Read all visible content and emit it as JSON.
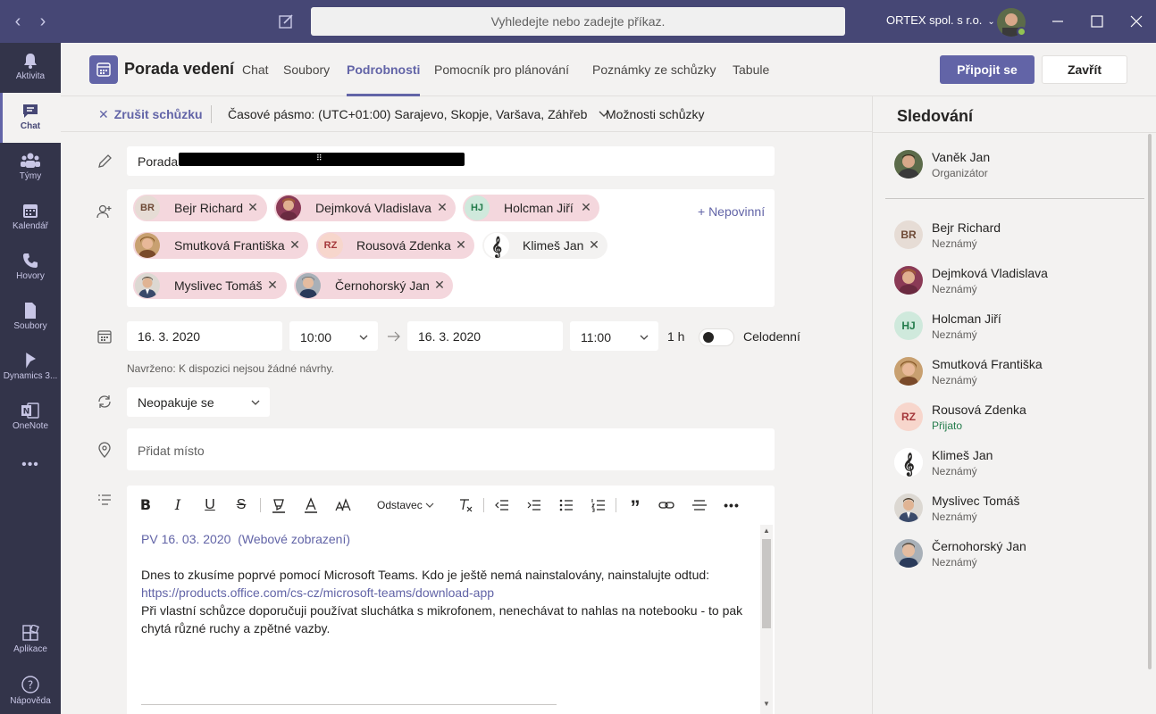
{
  "titlebar": {
    "search_placeholder": "Vyhledejte nebo zadejte příkaz.",
    "org_name": "ORTEX spol. s r.o."
  },
  "rail": {
    "items": [
      {
        "label": "Aktivita",
        "icon": "bell-icon"
      },
      {
        "label": "Chat",
        "icon": "chat-icon"
      },
      {
        "label": "Týmy",
        "icon": "teams-icon"
      },
      {
        "label": "Kalendář",
        "icon": "calendar-icon"
      },
      {
        "label": "Hovory",
        "icon": "phone-icon"
      },
      {
        "label": "Soubory",
        "icon": "file-icon"
      },
      {
        "label": "Dynamics 3...",
        "icon": "dynamics-icon"
      },
      {
        "label": "OneNote",
        "icon": "onenote-icon"
      }
    ],
    "more": "•••",
    "apps_label": "Aplikace",
    "help_label": "Nápověda"
  },
  "header": {
    "title": "Porada vedení",
    "tabs": [
      "Chat",
      "Soubory",
      "Podrobnosti",
      "Pomocník pro plánování",
      "Poznámky ze schůzky",
      "Tabule"
    ],
    "active_tab": "Podrobnosti",
    "join_label": "Připojit se",
    "close_label": "Zavřít"
  },
  "toolbar": {
    "cancel_label": "Zrušit schůzku",
    "timezone": "Časové pásmo: (UTC+01:00) Sarajevo, Skopje, Varšava, Záhřeb",
    "options_label": "Možnosti schůzky"
  },
  "form": {
    "title_value": "Porada",
    "title_redacted_glyph": "⠿",
    "attendees": [
      {
        "initials": "BR",
        "name": "Bejr Richard"
      },
      {
        "initials": "",
        "name": "Dejmková Vladislava"
      },
      {
        "initials": "HJ",
        "name": "Holcman Jiří"
      },
      {
        "initials": "",
        "name": "Smutková Františka"
      },
      {
        "initials": "RZ",
        "name": "Rousová Zdenka"
      },
      {
        "initials": "",
        "name": "Klimeš Jan"
      },
      {
        "initials": "",
        "name": "Myslivec Tomáš"
      },
      {
        "initials": "",
        "name": "Černohorský Jan"
      }
    ],
    "optional_label": "+ Nepovinní",
    "start_date": "16. 3. 2020",
    "start_time": "10:00",
    "end_date": "16. 3. 2020",
    "end_time": "11:00",
    "duration": "1 h",
    "all_day_label": "Celodenní",
    "suggestion": "Navrženo: K dispozici nejsou žádné návrhy.",
    "repeat_value": "Neopakuje se",
    "location_placeholder": "Přidat místo"
  },
  "editor": {
    "paragraph_label": "Odstavec",
    "line1_a": "PV 16. 03. 2020",
    "line1_b": "(Webové zobrazení)",
    "body_text": "Dnes to zkusíme poprvé pomocí Microsoft Teams. Kdo je ještě nemá nainstalovány, nainstalujte odtud:",
    "link": "https://products.office.com/cs-cz/microsoft-teams/download-app",
    "body_text2": "Při vlastní schůzce doporučuji používat sluchátka s mikrofonem, nenechávat to nahlas na notebooku - to pak chytá různé ruchy a zpětné vazby."
  },
  "panel": {
    "title": "Sledování",
    "organizer": {
      "name": "Vaněk Jan",
      "status": "Organizátor"
    },
    "people": [
      {
        "initials": "BR",
        "name": "Bejr Richard",
        "status": "Neznámý"
      },
      {
        "initials": "",
        "name": "Dejmková Vladislava",
        "status": "Neznámý"
      },
      {
        "initials": "HJ",
        "name": "Holcman Jiří",
        "status": "Neznámý"
      },
      {
        "initials": "",
        "name": "Smutková Františka",
        "status": "Neznámý"
      },
      {
        "initials": "RZ",
        "name": "Rousová Zdenka",
        "status": "Přijato"
      },
      {
        "initials": "",
        "name": "Klimeš Jan",
        "status": "Neznámý"
      },
      {
        "initials": "",
        "name": "Myslivec Tomáš",
        "status": "Neznámý"
      },
      {
        "initials": "",
        "name": "Černohorský Jan",
        "status": "Neznámý"
      }
    ]
  },
  "colors": {
    "brand": "#6264a7",
    "titlebar": "#464775",
    "rail": "#33344a",
    "chip": "#f4d7dd",
    "accepted": "#237b4b"
  }
}
